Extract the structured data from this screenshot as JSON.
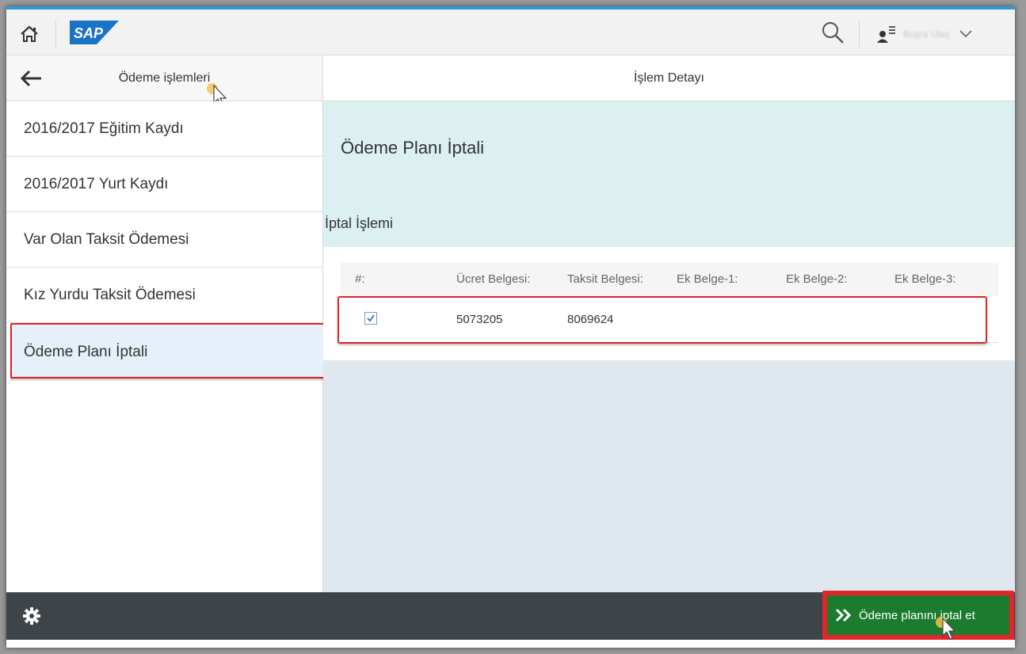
{
  "app": {
    "logo_text": "SAP",
    "user_name": "Buşra Ulaş"
  },
  "left_panel": {
    "title": "Ödeme işlemleri",
    "items": [
      {
        "label": "2016/2017 Eğitim Kaydı"
      },
      {
        "label": "2016/2017 Yurt Kaydı"
      },
      {
        "label": "Var Olan Taksit Ödemesi"
      },
      {
        "label": "Kız Yurdu Taksit Ödemesi"
      },
      {
        "label": "Ödeme Planı İptali",
        "selected": true
      }
    ]
  },
  "detail": {
    "header": "İşlem Detayı",
    "title": "Ödeme Planı İptali",
    "section_title": "İptal İşlemi",
    "table": {
      "columns": [
        "#:",
        "Ücret Belgesi:",
        "Taksit Belgesi:",
        "Ek Belge-1:",
        "Ek Belge-2:",
        "Ek Belge-3:"
      ],
      "rows": [
        {
          "checked": true,
          "cells": [
            "",
            "5073205",
            "8069624",
            "",
            "",
            ""
          ]
        }
      ]
    }
  },
  "footer": {
    "action_label": "Ödeme planını iptal et"
  },
  "colors": {
    "accent": "#2f97d5",
    "highlight": "#e3252b",
    "action_green": "#1b7c2f",
    "footer_dark": "#3f4449"
  },
  "icons": [
    "home-icon",
    "search-icon",
    "user-icon",
    "chevron-down-icon",
    "back-arrow-icon",
    "gear-icon",
    "double-chevron-right-icon",
    "checkbox-checked-icon",
    "cursor-icon"
  ]
}
